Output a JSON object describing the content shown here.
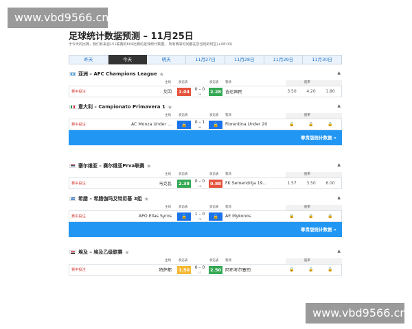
{
  "watermark": "www.vbd9566.cn",
  "title": "足球统计数据预测 – 11月25日",
  "subtitle": "于今天的比赛，我们有来自151联赛的604比赛的足球统计数据。 所有赛事时间都在您当地的时区(+08:00)",
  "tabs": [
    "昨天",
    "今天",
    "明天",
    "11月27日",
    "11月28日",
    "11月29日",
    "11月30日"
  ],
  "col_headers": {
    "home": "主场",
    "status1": "状态表",
    "status2": "状态表",
    "away": "客场",
    "odds": "赔率"
  },
  "hl_label": "赛中投注",
  "promo_label": "尊贵版统计数据 »",
  "leagues": [
    {
      "name": "亚洲 – AFC Champions League",
      "match": {
        "home": "艾因",
        "home_val": "1.04",
        "score": "0 – 0",
        "half": "58",
        "away_val": "2.28",
        "away": "吉达国民",
        "odds": [
          "3.50",
          "4.20",
          "1.80"
        ]
      }
    },
    {
      "name": "意大利 – Campionato Primavera 1",
      "match": {
        "home": "AC Monza Under ...",
        "score": "0 – 1",
        "half": "89",
        "away": "Fiorentina Under 20",
        "odds": [
          "🔒",
          "🔒",
          "🔒"
        ]
      }
    },
    {
      "name": "塞尔维亚 – 赛尔维亚Prva联赛",
      "match": {
        "home": "马克瓦",
        "home_val": "2.38",
        "score": "0 – 0",
        "half": "18",
        "away_val": "0.88",
        "away": "FK Semendrija 19...",
        "odds": [
          "1.57",
          "3.50",
          "6.00"
        ]
      }
    },
    {
      "name": "希腊 – 希腊伽玛艾特尼基 3组",
      "match": {
        "home": "APO Ellas Syros",
        "score": "1 – 0",
        "half": "78",
        "away": "AE Mykonos",
        "odds": [
          "🔒",
          "🔒",
          "🔒"
        ]
      }
    },
    {
      "name": "埃及 – 埃及乙级联赛",
      "match": {
        "home": "特萨都",
        "home_val": "1.50",
        "score": "0 – 0",
        "half": "17",
        "away_val": "2.50",
        "away": "阿布考尔塞司",
        "odds": [
          "🔒",
          "🔒",
          "🔒"
        ]
      }
    }
  ]
}
